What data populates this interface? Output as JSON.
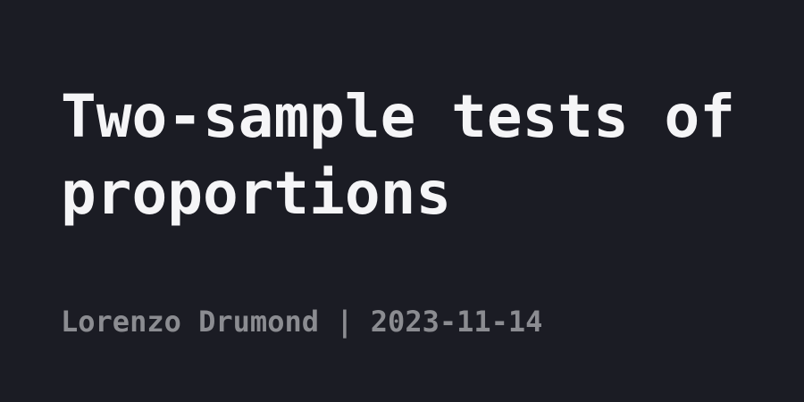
{
  "title": "Two-sample tests of proportions",
  "byline": {
    "author": "Lorenzo Drumond",
    "separator": "|",
    "date": "2023-11-14"
  },
  "colors": {
    "background": "#1b1c24",
    "title": "#f5f5f7",
    "byline": "#8b8c91"
  }
}
